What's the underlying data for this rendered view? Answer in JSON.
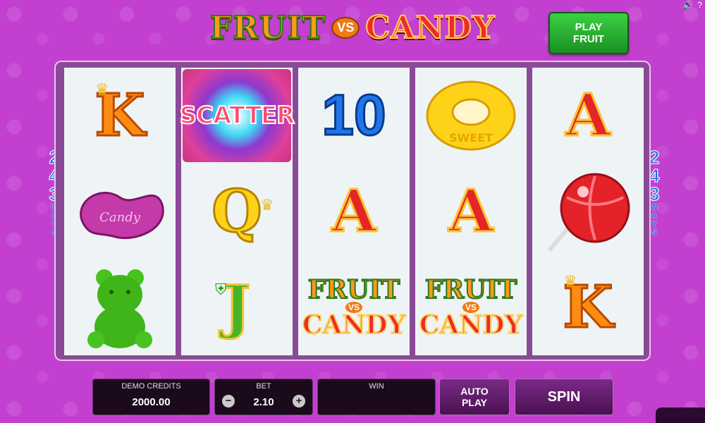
{
  "header": {
    "title_fruit": "FRUIT",
    "title_vs": "VS",
    "title_candy": "CANDY",
    "play_fruit_label": "PLAY\nFRUIT",
    "sound_icon": "speaker-icon",
    "help_icon": "?"
  },
  "ways": {
    "left": {
      "digits": [
        "2",
        "4",
        "3"
      ],
      "word": "WAYS"
    },
    "right": {
      "digits": [
        "2",
        "4",
        "3"
      ],
      "word": "WAYS"
    }
  },
  "reels": [
    [
      {
        "symbol": "K",
        "type": "letter-k"
      },
      {
        "symbol": "Candy",
        "type": "jellybean"
      },
      {
        "symbol": "gummy-bear",
        "type": "gummy-bear"
      }
    ],
    [
      {
        "symbol": "SCATTER",
        "type": "scatter"
      },
      {
        "symbol": "Q",
        "type": "letter-q"
      },
      {
        "symbol": "J",
        "type": "letter-j"
      }
    ],
    [
      {
        "symbol": "10",
        "type": "number-10"
      },
      {
        "symbol": "A",
        "type": "letter-a"
      },
      {
        "symbol": "FRUIT VS CANDY",
        "type": "wild-logo"
      }
    ],
    [
      {
        "symbol": "SWEET",
        "type": "ring-candy"
      },
      {
        "symbol": "A",
        "type": "letter-a"
      },
      {
        "symbol": "FRUIT VS CANDY",
        "type": "wild-logo"
      }
    ],
    [
      {
        "symbol": "A",
        "type": "letter-a"
      },
      {
        "symbol": "lollipop",
        "type": "lollipop"
      },
      {
        "symbol": "K",
        "type": "letter-k"
      }
    ]
  ],
  "bottom_bar": {
    "credits": {
      "label": "DEMO CREDITS",
      "value": "2000.00"
    },
    "bet": {
      "label": "BET",
      "value": "2.10",
      "minus": "−",
      "plus": "+"
    },
    "win": {
      "label": "WIN",
      "value": ""
    },
    "autoplay_label": "AUTO\nPLAY",
    "spin_label": "SPIN"
  },
  "colors": {
    "background": "#c23fd0",
    "reel_bg": "#eef4f6",
    "frame": "#8b4a97",
    "play_button": "#2bb034"
  }
}
